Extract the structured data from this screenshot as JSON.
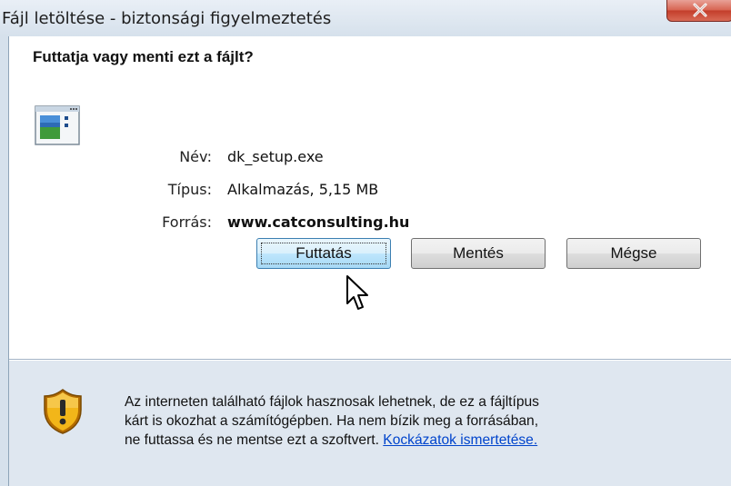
{
  "window": {
    "title": "Fájl letöltése - biztonsági figyelmeztetés",
    "close_icon": "close-icon"
  },
  "dialog": {
    "question": "Futtatja vagy menti ezt a fájlt?",
    "file_icon": "executable-file-icon",
    "fields": {
      "name_label": "Név:",
      "name_value": "dk_setup.exe",
      "type_label": "Típus:",
      "type_value": "Alkalmazás, 5,15 MB",
      "source_label": "Forrás:",
      "source_value": "www.catconsulting.hu"
    },
    "buttons": {
      "run": "Futtatás",
      "save": "Mentés",
      "cancel": "Mégse"
    }
  },
  "footer": {
    "icon": "security-shield-warning-icon",
    "line1": "Az interneten található fájlok hasznosak lehetnek, de ez a fájltípus",
    "line2": "kárt is okozhat a számítógépben. Ha nem bízik meg a forrásában,",
    "line3_prefix": "ne futtassa és ne mentse ezt a szoftvert. ",
    "link": "Kockázatok ismertetése."
  },
  "colors": {
    "link": "#0044cc",
    "frame": "#dfe7f0",
    "close_button": "#c33d2a"
  }
}
